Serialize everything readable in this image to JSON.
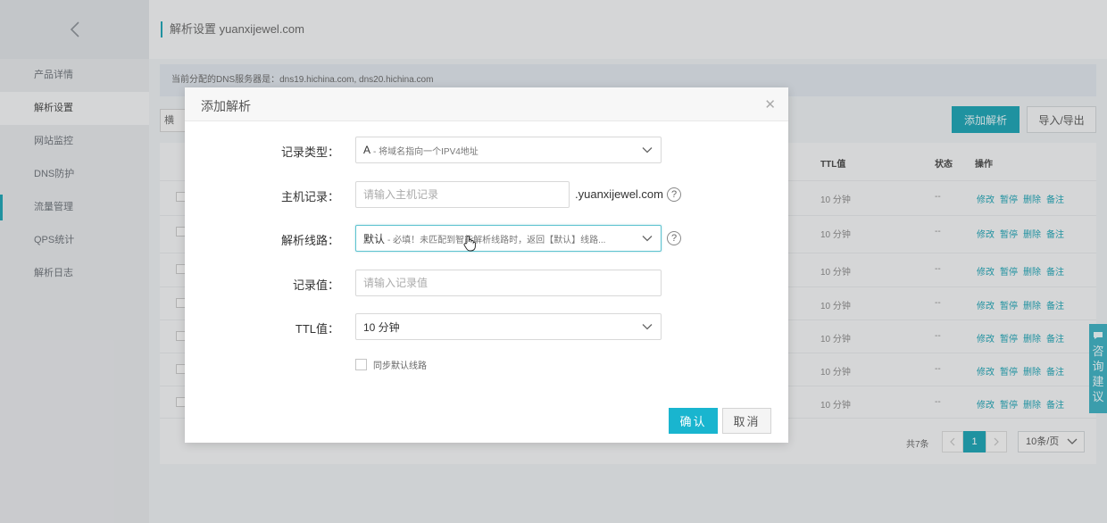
{
  "sidebar": {
    "items": [
      {
        "label": "产品详情"
      },
      {
        "label": "解析设置"
      },
      {
        "label": "网站监控"
      },
      {
        "label": "DNS防护"
      },
      {
        "label": "流量管理"
      },
      {
        "label": "QPS统计"
      },
      {
        "label": "解析日志"
      }
    ]
  },
  "header": {
    "title": "解析设置 yuanxijewel.com"
  },
  "dns_notice": "当前分配的DNS服务器是：dns19.hichina.com, dns20.hichina.com",
  "toolbar": {
    "left_label": "横",
    "add_button": "添加解析",
    "import_export": "导入/导出"
  },
  "table": {
    "headers": {
      "ttl": "TTL值",
      "status": "状态",
      "ops": "操作"
    },
    "rows": [
      {
        "ttl": "10 分钟",
        "status": "--"
      },
      {
        "ttl": "10 分钟",
        "status": "--"
      },
      {
        "ttl": "10 分钟",
        "status": "--"
      },
      {
        "ttl": "10 分钟",
        "status": "--"
      },
      {
        "ttl": "10 分钟",
        "status": "--"
      },
      {
        "ttl": "10 分钟",
        "status": "--"
      },
      {
        "ttl": "10 分钟",
        "status": "--"
      }
    ],
    "row_ops": [
      "修改",
      "暂停",
      "删除",
      "备注"
    ]
  },
  "pagination": {
    "total": "共7条",
    "current_page": "1",
    "page_size": "10条/页"
  },
  "side_float": {
    "label": "咨询建议"
  },
  "modal": {
    "title": "添加解析",
    "record_type": {
      "label": "记录类型：",
      "value": "A",
      "hint": "- 将域名指向一个IPV4地址"
    },
    "host_record": {
      "label": "主机记录：",
      "placeholder": "请输入主机记录",
      "suffix": ".yuanxijewel.com"
    },
    "line": {
      "label": "解析线路：",
      "value": "默认",
      "hint": "- 必填！未匹配到智能解析线路时，返回【默认】线路..."
    },
    "record_value": {
      "label": "记录值：",
      "placeholder": "请输入记录值"
    },
    "ttl": {
      "label": "TTL值：",
      "value": "10 分钟"
    },
    "sync_default": {
      "label": "同步默认线路"
    },
    "confirm": "确认",
    "cancel": "取消"
  },
  "colors": {
    "accent": "#19a1b2",
    "confirm": "#19b5cf",
    "link": "#1aa1b2"
  }
}
